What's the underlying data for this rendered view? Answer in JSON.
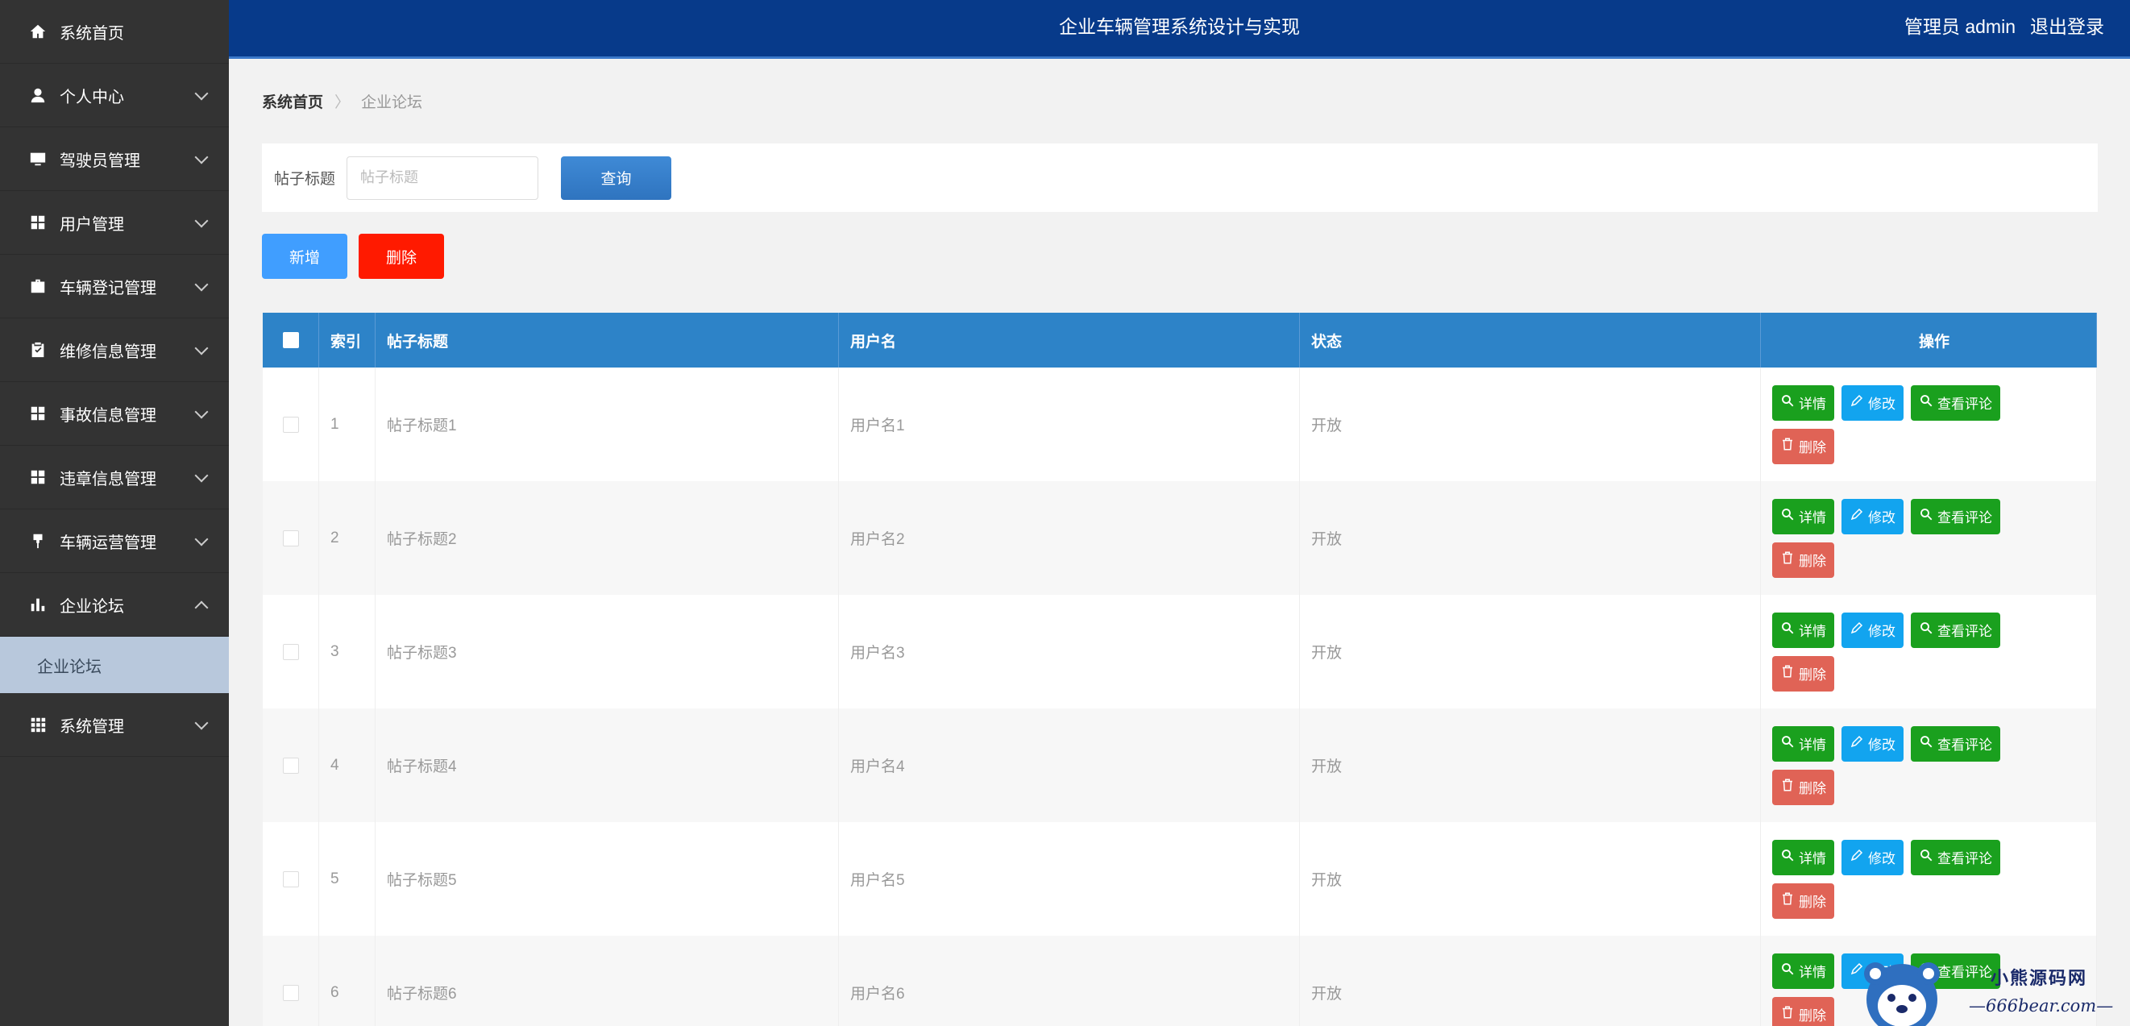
{
  "header": {
    "title": "企业车辆管理系统设计与实现",
    "user_label": "管理员 admin",
    "logout_label": "退出登录"
  },
  "sidebar": {
    "items": [
      {
        "label": "系统首页",
        "icon": "home-icon",
        "expanded": false,
        "has_children": false
      },
      {
        "label": "个人中心",
        "icon": "user-icon",
        "expanded": false,
        "has_children": true
      },
      {
        "label": "驾驶员管理",
        "icon": "monitor-icon",
        "expanded": false,
        "has_children": true
      },
      {
        "label": "用户管理",
        "icon": "grid-icon",
        "expanded": false,
        "has_children": true
      },
      {
        "label": "车辆登记管理",
        "icon": "briefcase-icon",
        "expanded": false,
        "has_children": true
      },
      {
        "label": "维修信息管理",
        "icon": "clipboard-icon",
        "expanded": false,
        "has_children": true
      },
      {
        "label": "事故信息管理",
        "icon": "grid-icon",
        "expanded": false,
        "has_children": true
      },
      {
        "label": "违章信息管理",
        "icon": "grid-icon",
        "expanded": false,
        "has_children": true
      },
      {
        "label": "车辆运营管理",
        "icon": "pin-icon",
        "expanded": false,
        "has_children": true
      },
      {
        "label": "企业论坛",
        "icon": "bar-chart-icon",
        "expanded": true,
        "has_children": true
      },
      {
        "label": "系统管理",
        "icon": "apps-icon",
        "expanded": false,
        "has_children": true
      }
    ],
    "submenu": {
      "label": "企业论坛",
      "parent_index": 9
    }
  },
  "breadcrumb": {
    "home": "系统首页",
    "separator": "〉",
    "current": "企业论坛"
  },
  "search": {
    "label": "帖子标题",
    "placeholder": "帖子标题",
    "value": "",
    "button": "查询"
  },
  "actions": {
    "add": "新增",
    "delete": "删除"
  },
  "table": {
    "columns": [
      "索引",
      "帖子标题",
      "用户名",
      "状态",
      "操作"
    ],
    "rows": [
      {
        "index": "1",
        "title": "帖子标题1",
        "user": "用户名1",
        "status": "开放"
      },
      {
        "index": "2",
        "title": "帖子标题2",
        "user": "用户名2",
        "status": "开放"
      },
      {
        "index": "3",
        "title": "帖子标题3",
        "user": "用户名3",
        "status": "开放"
      },
      {
        "index": "4",
        "title": "帖子标题4",
        "user": "用户名4",
        "status": "开放"
      },
      {
        "index": "5",
        "title": "帖子标题5",
        "user": "用户名5",
        "status": "开放"
      },
      {
        "index": "6",
        "title": "帖子标题6",
        "user": "用户名6",
        "status": "开放"
      }
    ],
    "row_ops": {
      "detail": "详情",
      "edit": "修改",
      "comments": "查看评论",
      "delete": "删除"
    }
  },
  "watermark": {
    "line1": "小熊源码网",
    "line2": "—666bear.com—"
  },
  "colors": {
    "sidebar_bg": "#333333",
    "header_bg": "#073a8a",
    "table_header": "#2d83c8",
    "btn_add": "#409eff",
    "btn_delete": "#ff1a00",
    "op_detail": "#1aa01e",
    "op_edit": "#12a4ef",
    "op_delete": "#e06356"
  }
}
